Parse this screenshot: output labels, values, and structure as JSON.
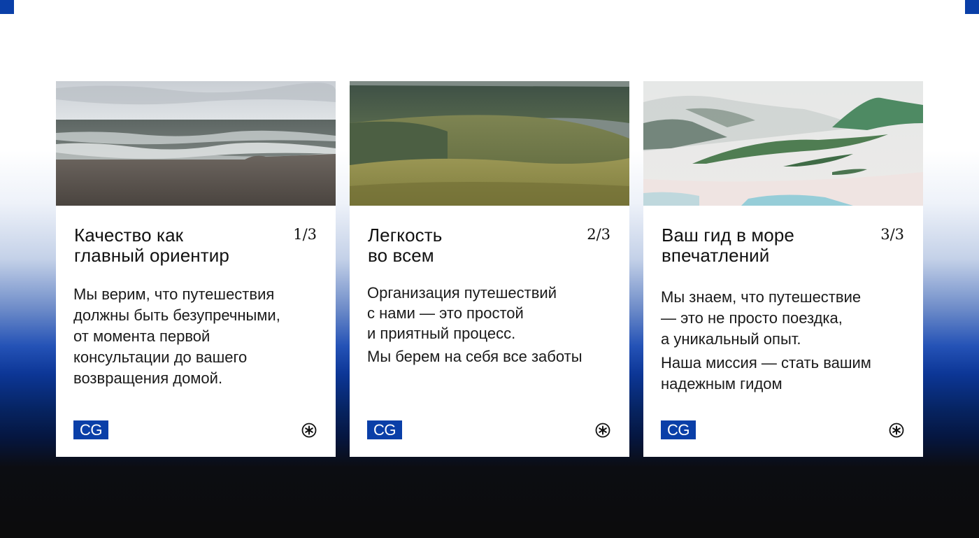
{
  "colors": {
    "accent": "#0a3fa8",
    "card_background": "#ffffff",
    "text": "#111111"
  },
  "cards": [
    {
      "title_lines": [
        "Качество как",
        "главный ориентир"
      ],
      "counter": "1/3",
      "body_lines": [
        "Мы верим, что путешествия",
        "должны быть безупречными,",
        "от момента первой",
        "консультации до вашего",
        "возвращения домой."
      ],
      "photo": "ocean-beach-photo",
      "logo": "CG",
      "icon": "asterisk-circle-icon"
    },
    {
      "title_lines": [
        "Легкость",
        "во всем"
      ],
      "counter": "2/3",
      "body_lines": [
        "Организация путешествий",
        "с нами — это простой",
        "и приятный процесс.",
        "Мы берем на себя все заботы"
      ],
      "photo": "green-hills-photo",
      "logo": "CG",
      "icon": "asterisk-circle-icon"
    },
    {
      "title_lines": [
        "Ваш гид в море",
        "впечатлений"
      ],
      "counter": "3/3",
      "body_lines": [
        "Мы знаем, что путешествие",
        "— это не просто поездка,",
        "а уникальный опыт.",
        "Наша миссия — стать вашим",
        "надежным гидом"
      ],
      "photo": "snowy-mountains-photo",
      "logo": "CG",
      "icon": "asterisk-circle-icon"
    }
  ]
}
